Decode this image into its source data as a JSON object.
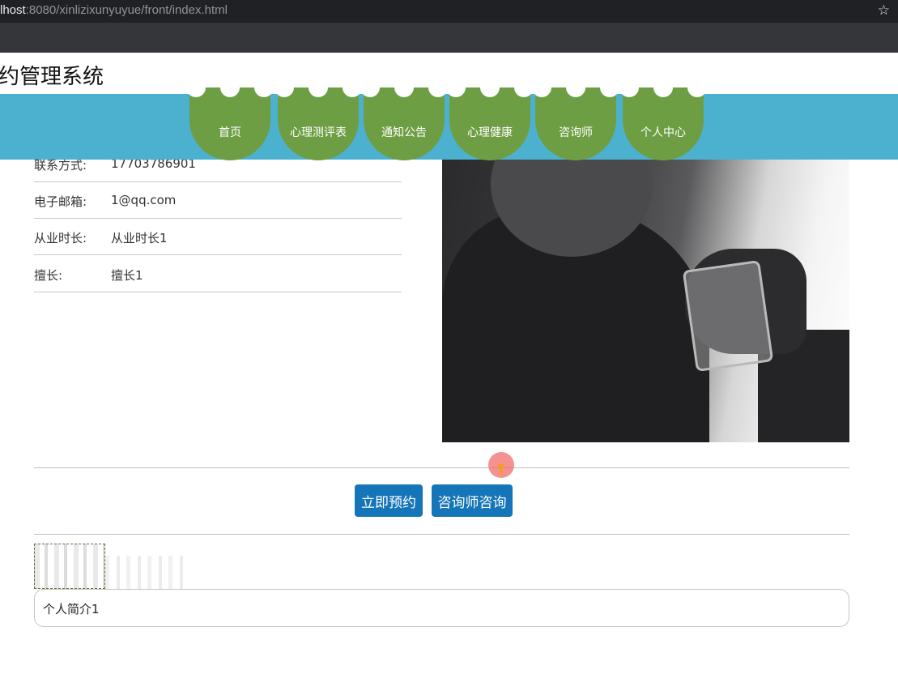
{
  "browser": {
    "url_host": "lhost",
    "url_path": ":8080/xinlizixunyuyue/front/index.html"
  },
  "site": {
    "title": "约管理系统"
  },
  "nav": {
    "items": [
      {
        "label": "首页"
      },
      {
        "label": "心理测评表"
      },
      {
        "label": "通知公告"
      },
      {
        "label": "心理健康"
      },
      {
        "label": "咨询师"
      },
      {
        "label": "个人中心"
      }
    ]
  },
  "details": {
    "rows": [
      {
        "label": "联系方式:",
        "value": "17703786901"
      },
      {
        "label": "电子邮箱:",
        "value": "1@qq.com"
      },
      {
        "label": "从业时长:",
        "value": "从业时长1"
      },
      {
        "label": "擅长:",
        "value": "擅长1"
      }
    ]
  },
  "actions": {
    "book_label": "立即预约",
    "consult_label": "咨询师咨询"
  },
  "intro": {
    "text": "个人简介1"
  },
  "colors": {
    "nav_bg": "#4cb1cf",
    "nav_item": "#6e9e43",
    "button": "#1475b9"
  }
}
